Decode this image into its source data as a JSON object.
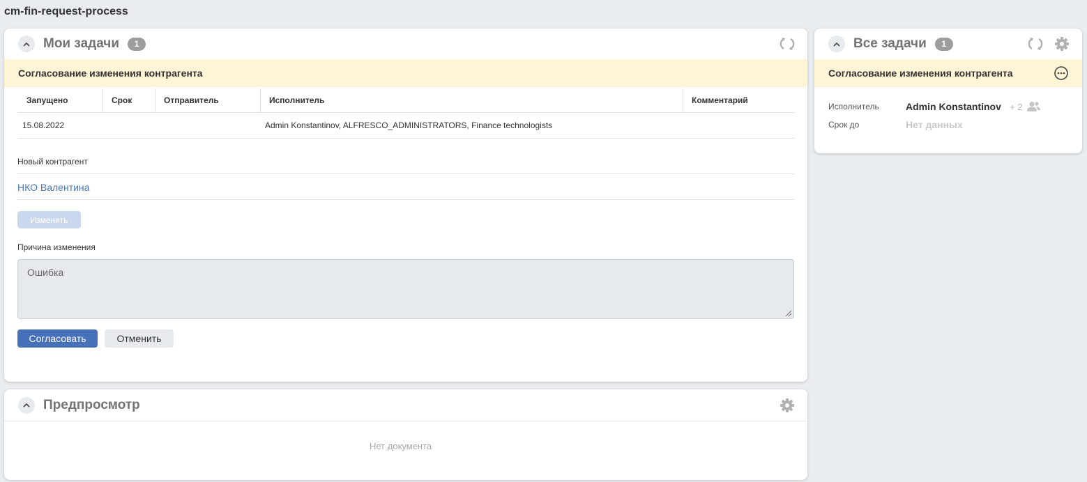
{
  "page": {
    "title": "cm-fin-request-process"
  },
  "my_tasks": {
    "title": "Мои задачи",
    "count": "1",
    "task_title": "Согласование изменения контрагента",
    "table": {
      "headers": [
        "Запущено",
        "Срок",
        "Отправитель",
        "Исполнитель",
        "Комментарий"
      ],
      "rows": [
        {
          "started": "15.08.2022",
          "deadline": "",
          "sender": "",
          "assignee": "Admin Konstantinov, ALFRESCO_ADMINISTRATORS, Finance technologists",
          "comment": ""
        }
      ]
    },
    "new_counterparty_label": "Новый контрагент",
    "new_counterparty_value": "НКО Валентина",
    "change_button": "Изменить",
    "reason_label": "Причина изменения",
    "reason_value": "Ошибка",
    "approve_button": "Согласовать",
    "cancel_button": "Отменить"
  },
  "preview": {
    "title": "Предпросмотр",
    "empty_text": "Нет документа"
  },
  "all_tasks": {
    "title": "Все задачи",
    "count": "1",
    "task_title": "Согласование изменения контрагента",
    "assignee_label": "Исполнитель",
    "assignee_value": "Admin Konstantinov",
    "assignee_more": "+ 2",
    "due_label": "Срок до",
    "due_value": "Нет данных"
  },
  "icons": {
    "collapse": "chevron-up-icon",
    "refresh": "refresh-icon",
    "settings": "gear-icon",
    "more": "more-options-icon",
    "group": "users-icon"
  },
  "colors": {
    "background": "#e9edf0",
    "banner": "#fff4d6",
    "primary": "#4671b8",
    "link": "#4a77b5",
    "badge": "#9d9d9d"
  }
}
